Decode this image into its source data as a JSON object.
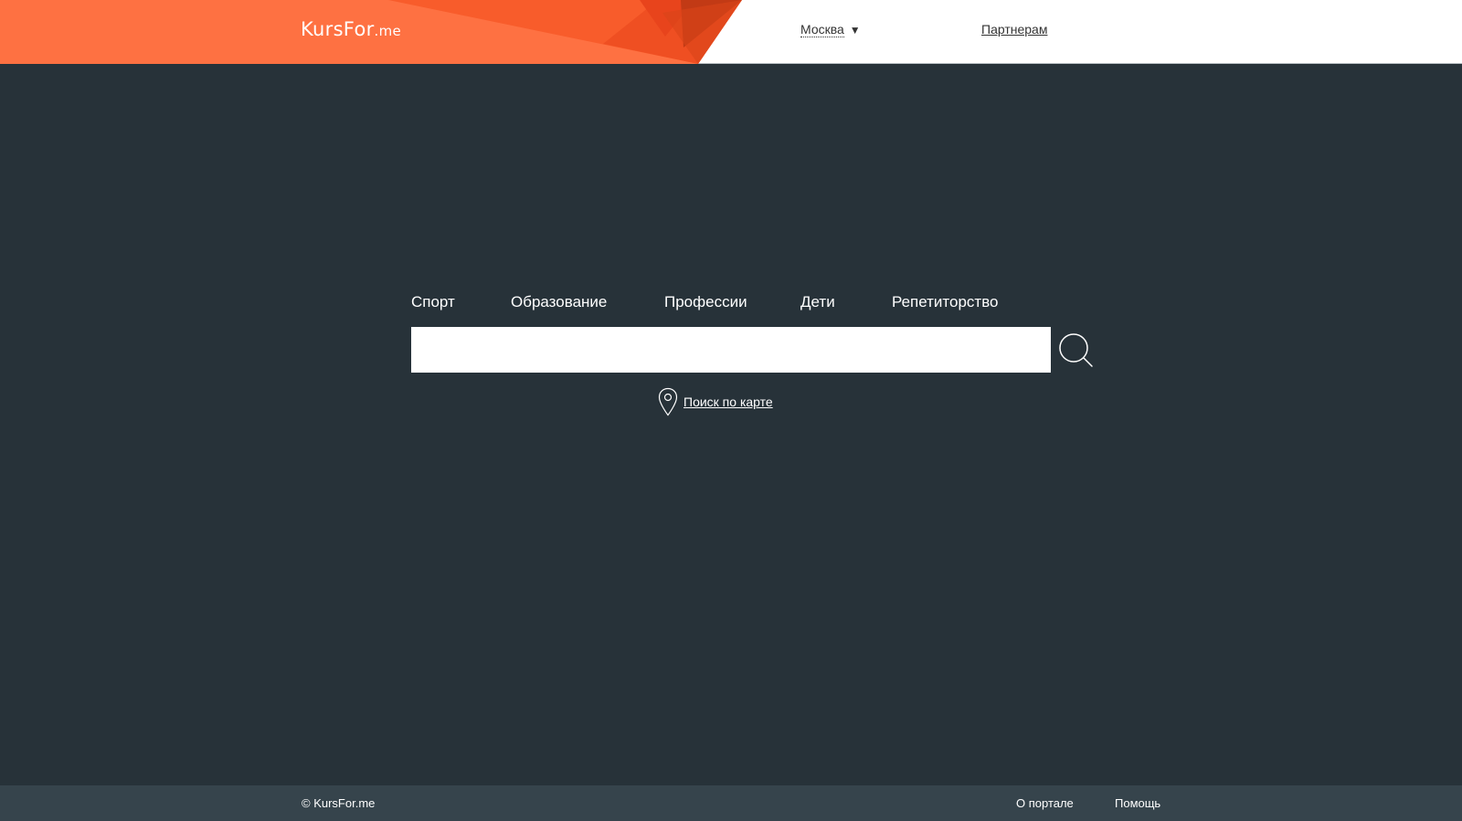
{
  "header": {
    "logo_main": "KursFor",
    "logo_sub": ".me",
    "city": "Москва",
    "city_caret": "▼",
    "partners": "Партнерам"
  },
  "categories": [
    "Спорт",
    "Образование",
    "Профессии",
    "Дети",
    "Репетиторство"
  ],
  "search": {
    "placeholder": "",
    "value": ""
  },
  "map_search_label": "Поиск по карте",
  "footer": {
    "copyright": "© KursFor.me",
    "links": [
      "О портале",
      "Помощь"
    ]
  },
  "colors": {
    "accent": "#f26a3c",
    "background": "#273239",
    "footer_bg": "#36444c"
  },
  "icons": [
    "search-icon",
    "map-pin-icon",
    "chevron-down-icon"
  ]
}
